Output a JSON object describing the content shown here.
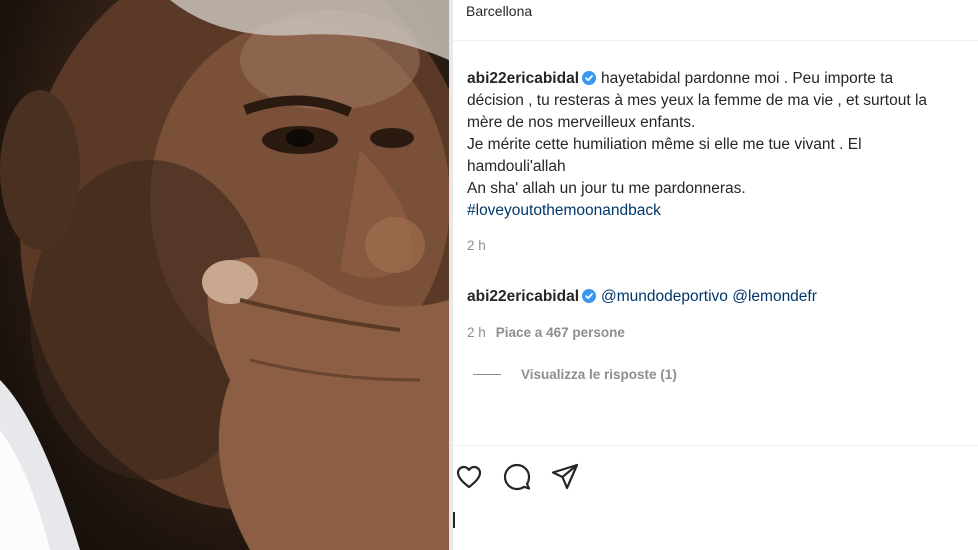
{
  "post": {
    "location": "Barcellona",
    "caption": {
      "username": "abi22ericabidal",
      "verified": true,
      "line1": "hayetabidal pardonne moi . Peu importe ta",
      "line2": "décision , tu resteras à mes yeux la femme de ma vie , et surtout la",
      "line3": "mère de nos merveilleux enfants.",
      "line4": "Je mérite cette humiliation même si elle me tue vivant . El",
      "line5": "hamdouli'allah",
      "line6": "An sha' allah un jour tu me pardonneras.",
      "hashtag": "#loveyoutothemoonandback",
      "time": "2 h"
    },
    "comment": {
      "username": "abi22ericabidal",
      "verified": true,
      "mention1": "@mundodeportivo",
      "mention2": "@lemondefr",
      "time": "2 h",
      "likes": "Piace a 467 persone"
    },
    "replies": {
      "label": "Visualizza le risposte (1)"
    },
    "actions": {
      "icons": [
        "heart-icon",
        "comment-icon",
        "share-icon"
      ]
    }
  },
  "colors": {
    "link": "#00376b",
    "secondary_text": "#8e8e8e",
    "verified": "#3897f0"
  }
}
